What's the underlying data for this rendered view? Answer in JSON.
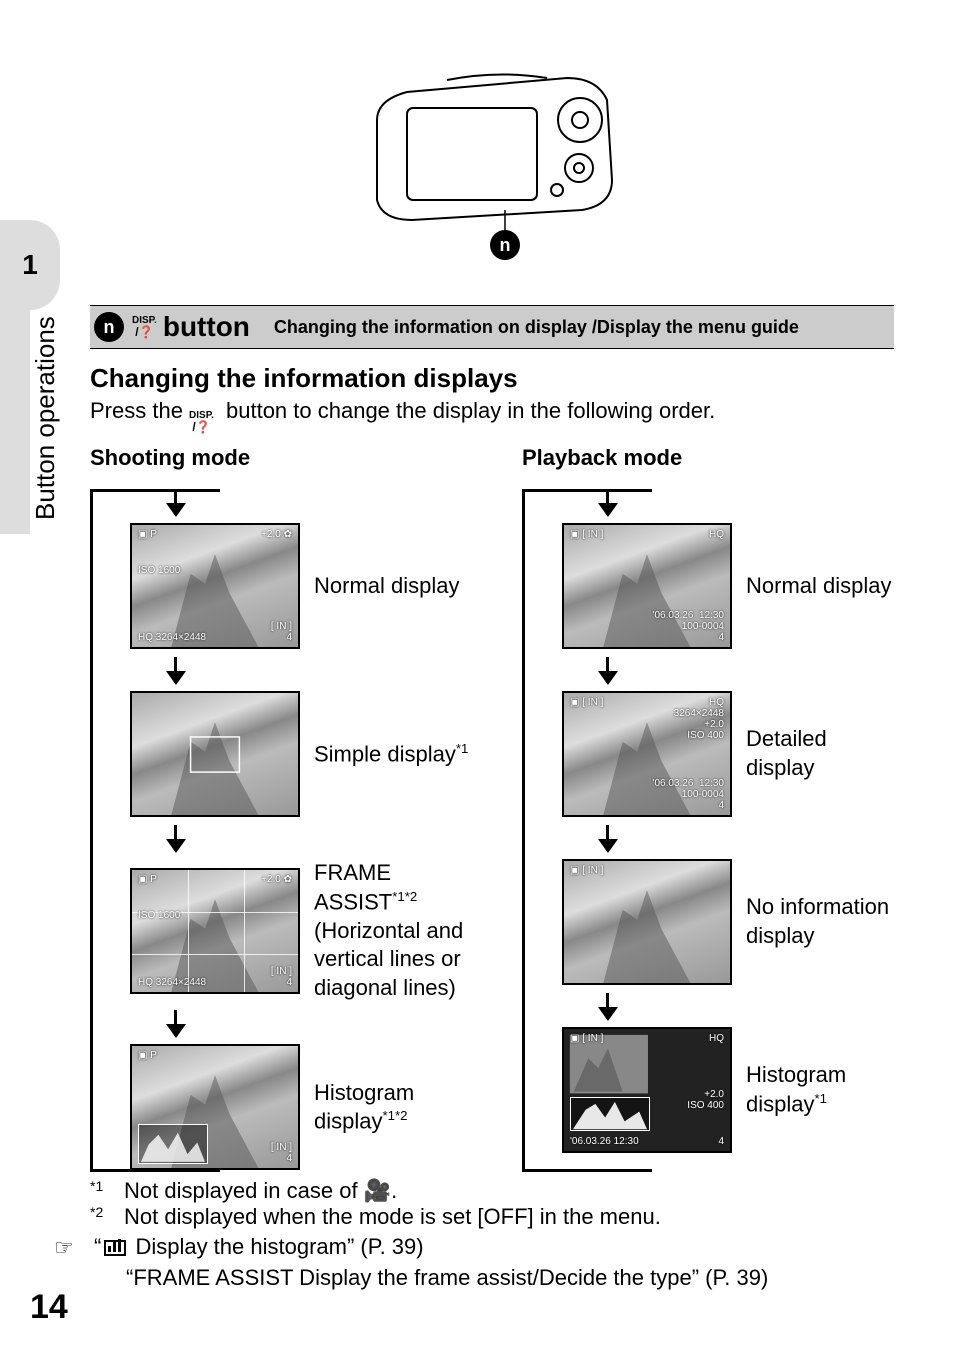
{
  "sidebar": {
    "chapter_number": "1",
    "chapter_title": "Button operations"
  },
  "page_number": "14",
  "callout_number": "n",
  "heading": {
    "label_button": "button",
    "right": "Changing the information on display /Display the menu guide"
  },
  "subheading": "Changing the information displays",
  "paragraph_pre": "Press the ",
  "paragraph_post": " button to change the display in the following order.",
  "mode_left_title": "Shooting mode",
  "mode_right_title": "Playback mode",
  "shooting": {
    "s1_label": "Normal display",
    "s1": {
      "tl": "P",
      "tr": "+2.0",
      "ml": "ISO 1600",
      "bl": "HQ 3264×2448",
      "br": "[ IN ]\n4"
    },
    "s2_label_pre": "Simple display",
    "s2_label_sup": "*1",
    "s3_label_line1_pre": "FRAME ASSIST",
    "s3_label_line1_sup": "*1*2",
    "s3_label_line2": "(Horizontal and vertical lines or diagonal lines)",
    "s3": {
      "tl": "P",
      "tr": "+2.0",
      "ml": "ISO 1600",
      "bl": "HQ 3264×2448",
      "br": "[ IN ]\n4"
    },
    "s4_label_pre": "Histogram display",
    "s4_label_sup": "*1*2",
    "s4": {
      "tl": "P",
      "br": "[ IN ]\n4"
    }
  },
  "playback": {
    "p1_label": "Normal display",
    "p1": {
      "tl": "[ IN ]",
      "tr": "HQ",
      "br": "'06.03.26  12:30\n100-0004\n4"
    },
    "p2_label": "Detailed display",
    "p2": {
      "tl": "[ IN ]",
      "tr": "HQ\n3264×2448\n+2.0\nISO 400",
      "br": "'06.03.26  12:30\n100-0004\n4"
    },
    "p3_label": "No information display",
    "p3": {
      "tl": "[ IN ]"
    },
    "p4_label_pre": "Histogram display",
    "p4_label_sup": "*1",
    "p4": {
      "tl": "[ IN ]",
      "tr": "HQ",
      "mr": "+2.0\nISO 400",
      "bl": "'06.03.26  12:30",
      "br": "4"
    }
  },
  "footnotes": {
    "f1_mark": "*1",
    "f1_text_pre": "Not displayed in case of ",
    "f1_text_post": ".",
    "f2_mark": "*2",
    "f2_text": "Not displayed when the mode is set [OFF] in the menu."
  },
  "refs": {
    "r1_pre": "“",
    "r1_post": " Display the histogram” (P. 39)",
    "r2": "“FRAME ASSIST Display the frame assist/Decide the type” (P. 39)"
  }
}
